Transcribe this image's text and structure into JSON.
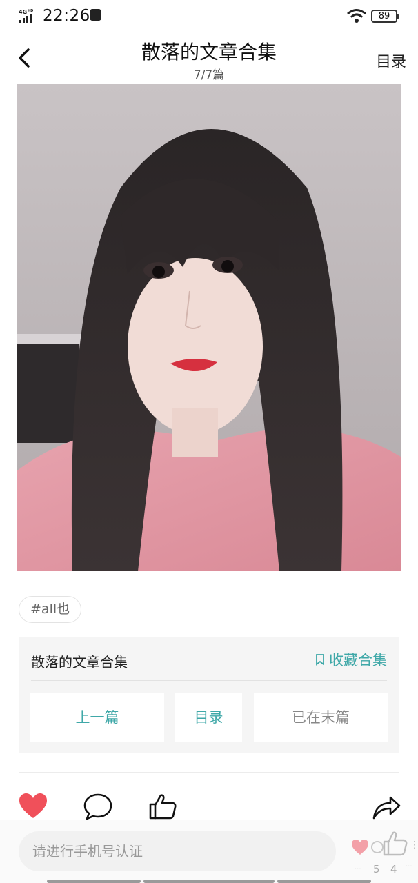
{
  "status_bar": {
    "network": "4GHD",
    "time": "22:26",
    "battery": "89"
  },
  "header": {
    "title": "散落的文章合集",
    "subtitle": "7/7篇",
    "toc_label": "目录"
  },
  "article": {
    "tag": "#all也"
  },
  "collection": {
    "title": "散落的文章合集",
    "favorite_label": "收藏合集",
    "prev_label": "上一篇",
    "toc_label": "目录",
    "end_label": "已在末篇"
  },
  "bottom_bar": {
    "input_placeholder": "请进行手机号认证",
    "count_dots": "···",
    "count_a": "5",
    "count_b": "4",
    "count_c": "···"
  },
  "colors": {
    "accent": "#3fa8a8",
    "like_red": "#f0505a",
    "muted_text": "#888888"
  },
  "icons": [
    "signal-icon",
    "message-icon",
    "wifi-icon",
    "back-arrow-icon",
    "bookmark-icon",
    "heart-icon",
    "comment-icon",
    "thumbs-up-icon",
    "share-icon"
  ]
}
